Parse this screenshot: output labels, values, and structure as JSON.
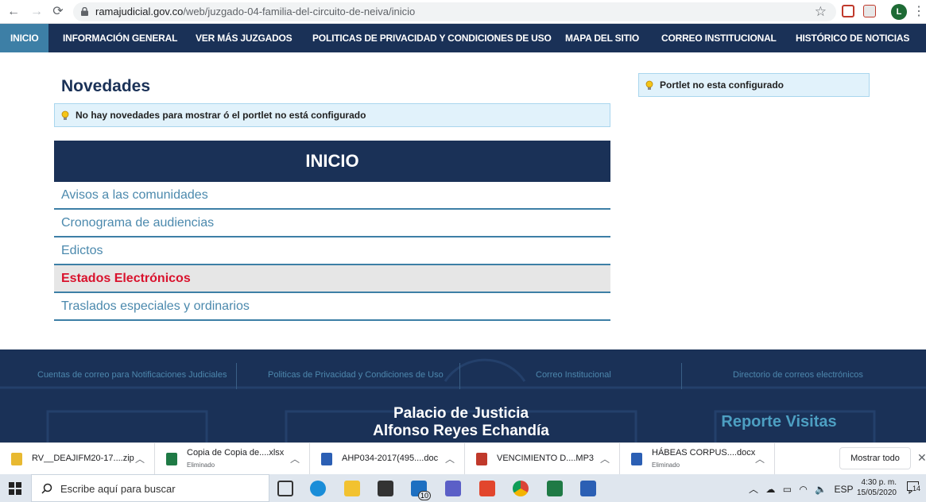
{
  "browser": {
    "url_host": "ramajudicial.gov.co",
    "url_path": "/web/juzgado-04-familia-del-circuito-de-neiva/inicio",
    "avatar_letter": "L"
  },
  "nav": {
    "items": [
      "INICIO",
      "INFORMACIÓN GENERAL",
      "VER MÁS JUZGADOS",
      "POLITICAS DE PRIVACIDAD Y CONDICIONES DE USO",
      "MAPA DEL SITIO",
      "CORREO INSTITUCIONAL",
      "HISTÓRICO DE NOTICIAS"
    ],
    "active": "INICIO"
  },
  "main": {
    "title": "Novedades",
    "notice": "No hay novedades para mostrar ó el portlet no está configurado",
    "menu_title": "INICIO",
    "menu_items": [
      "Avisos a las comunidades",
      "Cronograma de audiencias",
      "Edictos",
      "Estados Electrónicos",
      "Traslados especiales y ordinarios"
    ],
    "selected_item": "Estados Electrónicos"
  },
  "sidebar": {
    "notice": "Portlet no esta configurado"
  },
  "footer": {
    "links": [
      "Cuentas de correo para Notificaciones Judiciales",
      "Politicas de Privacidad y Condiciones de Uso",
      "Correo Institucional",
      "Directorio de correos electrónicos"
    ],
    "palace_line1": "Palacio de Justicia",
    "palace_line2": "Alfonso Reyes Echandía",
    "reporte": "Reporte Visitas"
  },
  "downloads": {
    "items": [
      {
        "name": "RV__DEAJIFM20-17....zip",
        "sub": "",
        "icon_color": "#e8b931"
      },
      {
        "name": "Copia de Copia de....xlsx",
        "sub": "Eliminado",
        "icon_color": "#1f7a45"
      },
      {
        "name": "AHP034-2017(495....doc",
        "sub": "",
        "icon_color": "#2b5fb4"
      },
      {
        "name": "VENCIMIENTO D....MP3",
        "sub": "",
        "icon_color": "#c0392b"
      },
      {
        "name": "HÁBEAS CORPUS....docx",
        "sub": "Eliminado",
        "icon_color": "#2b5fb4"
      }
    ],
    "show_all": "Mostrar todo"
  },
  "taskbar": {
    "search_placeholder": "Escribe aquí para buscar",
    "mail_badge": "10",
    "lang": "ESP",
    "time": "4:30 p. m.",
    "date": "15/05/2020",
    "notifications": "14"
  }
}
